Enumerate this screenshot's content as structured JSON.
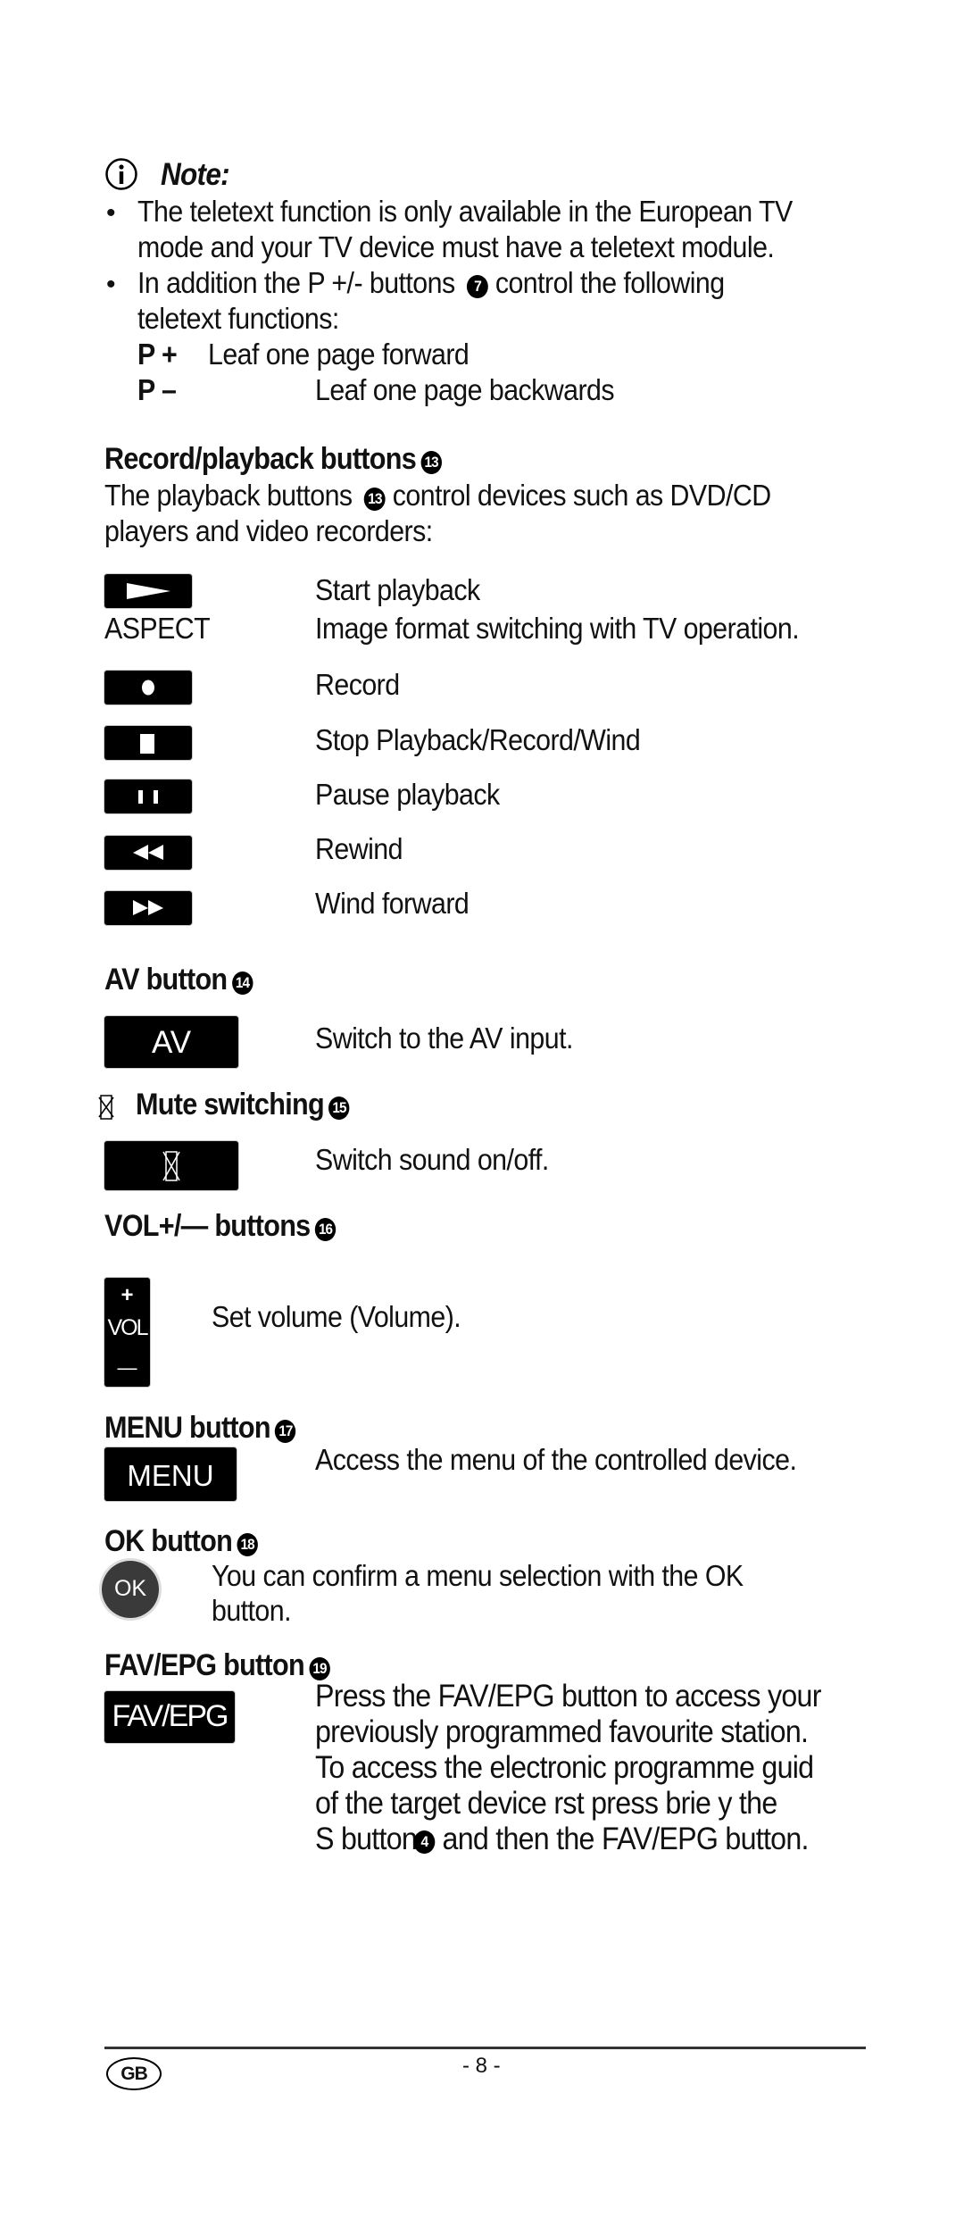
{
  "note": {
    "icon": "info-circle-icon",
    "title": "Note:",
    "bullets": [
      [
        "The teletext function is only available in the European TV",
        "mode and your TV device must have a teletext module."
      ],
      [
        "In addition the P +/- buttons",
        "control the following",
        "teletext functions:"
      ]
    ],
    "bullet2_ref": "7",
    "p_plus_key": "P +",
    "p_plus_desc": "Leaf one page forward",
    "p_minus_key": "P –",
    "p_minus_desc": "Leaf one page backwards"
  },
  "record_playback": {
    "heading": "Record/playback buttons",
    "ref": "13",
    "intro_line1_a": "The playback buttons",
    "intro_line1_b": "control devices such as DVD/CD",
    "intro_line2": "players and video recorders:",
    "items": [
      {
        "icon": "play-icon",
        "label": "",
        "desc": "Start playback"
      },
      {
        "icon": "",
        "label": "ASPECT",
        "desc": "Image format switching with TV operation."
      },
      {
        "icon": "record-icon",
        "label": "",
        "desc": "Record"
      },
      {
        "icon": "stop-icon",
        "label": "",
        "desc": "Stop Playback/Record/Wind"
      },
      {
        "icon": "pause-icon",
        "label": "",
        "desc": "Pause playback"
      },
      {
        "icon": "rewind-icon",
        "label": "",
        "desc": "Rewind"
      },
      {
        "icon": "fast-forward-icon",
        "label": "",
        "desc": "Wind forward"
      }
    ]
  },
  "av": {
    "heading": "AV button",
    "ref": "14",
    "key_label": "AV",
    "desc": "Switch to the AV input."
  },
  "mute": {
    "heading": "Mute switching",
    "ref": "15",
    "icon": "mute-icon",
    "desc": "Switch sound on/off."
  },
  "vol": {
    "heading": "VOL+/— buttons",
    "ref": "16",
    "key_plus": "+",
    "key_label": "VOL",
    "key_minus": "—",
    "desc": "Set volume (Volume)."
  },
  "menu": {
    "heading": "MENU button",
    "ref": "17",
    "key_label": "MENU",
    "desc": "Access the menu of the controlled device."
  },
  "ok": {
    "heading": "OK button",
    "ref": "18",
    "key_label": "OK",
    "desc_line1": "You can confirm a menu selection with the OK",
    "desc_line2": "button."
  },
  "fav": {
    "heading": "FAV/EPG button",
    "ref": "19",
    "key_label": "FAV/EPG",
    "lines": [
      "Press the FAV/EPG button to access your",
      "previously programmed favourite station.",
      "To access the electronic programme guid",
      "of the target device  rst press brie y the",
      "S button"
    ],
    "line5_ref": "4",
    "line5_tail": " and then the FAV/EPG button."
  },
  "footer": {
    "country": "GB",
    "page": "- 8 -"
  }
}
